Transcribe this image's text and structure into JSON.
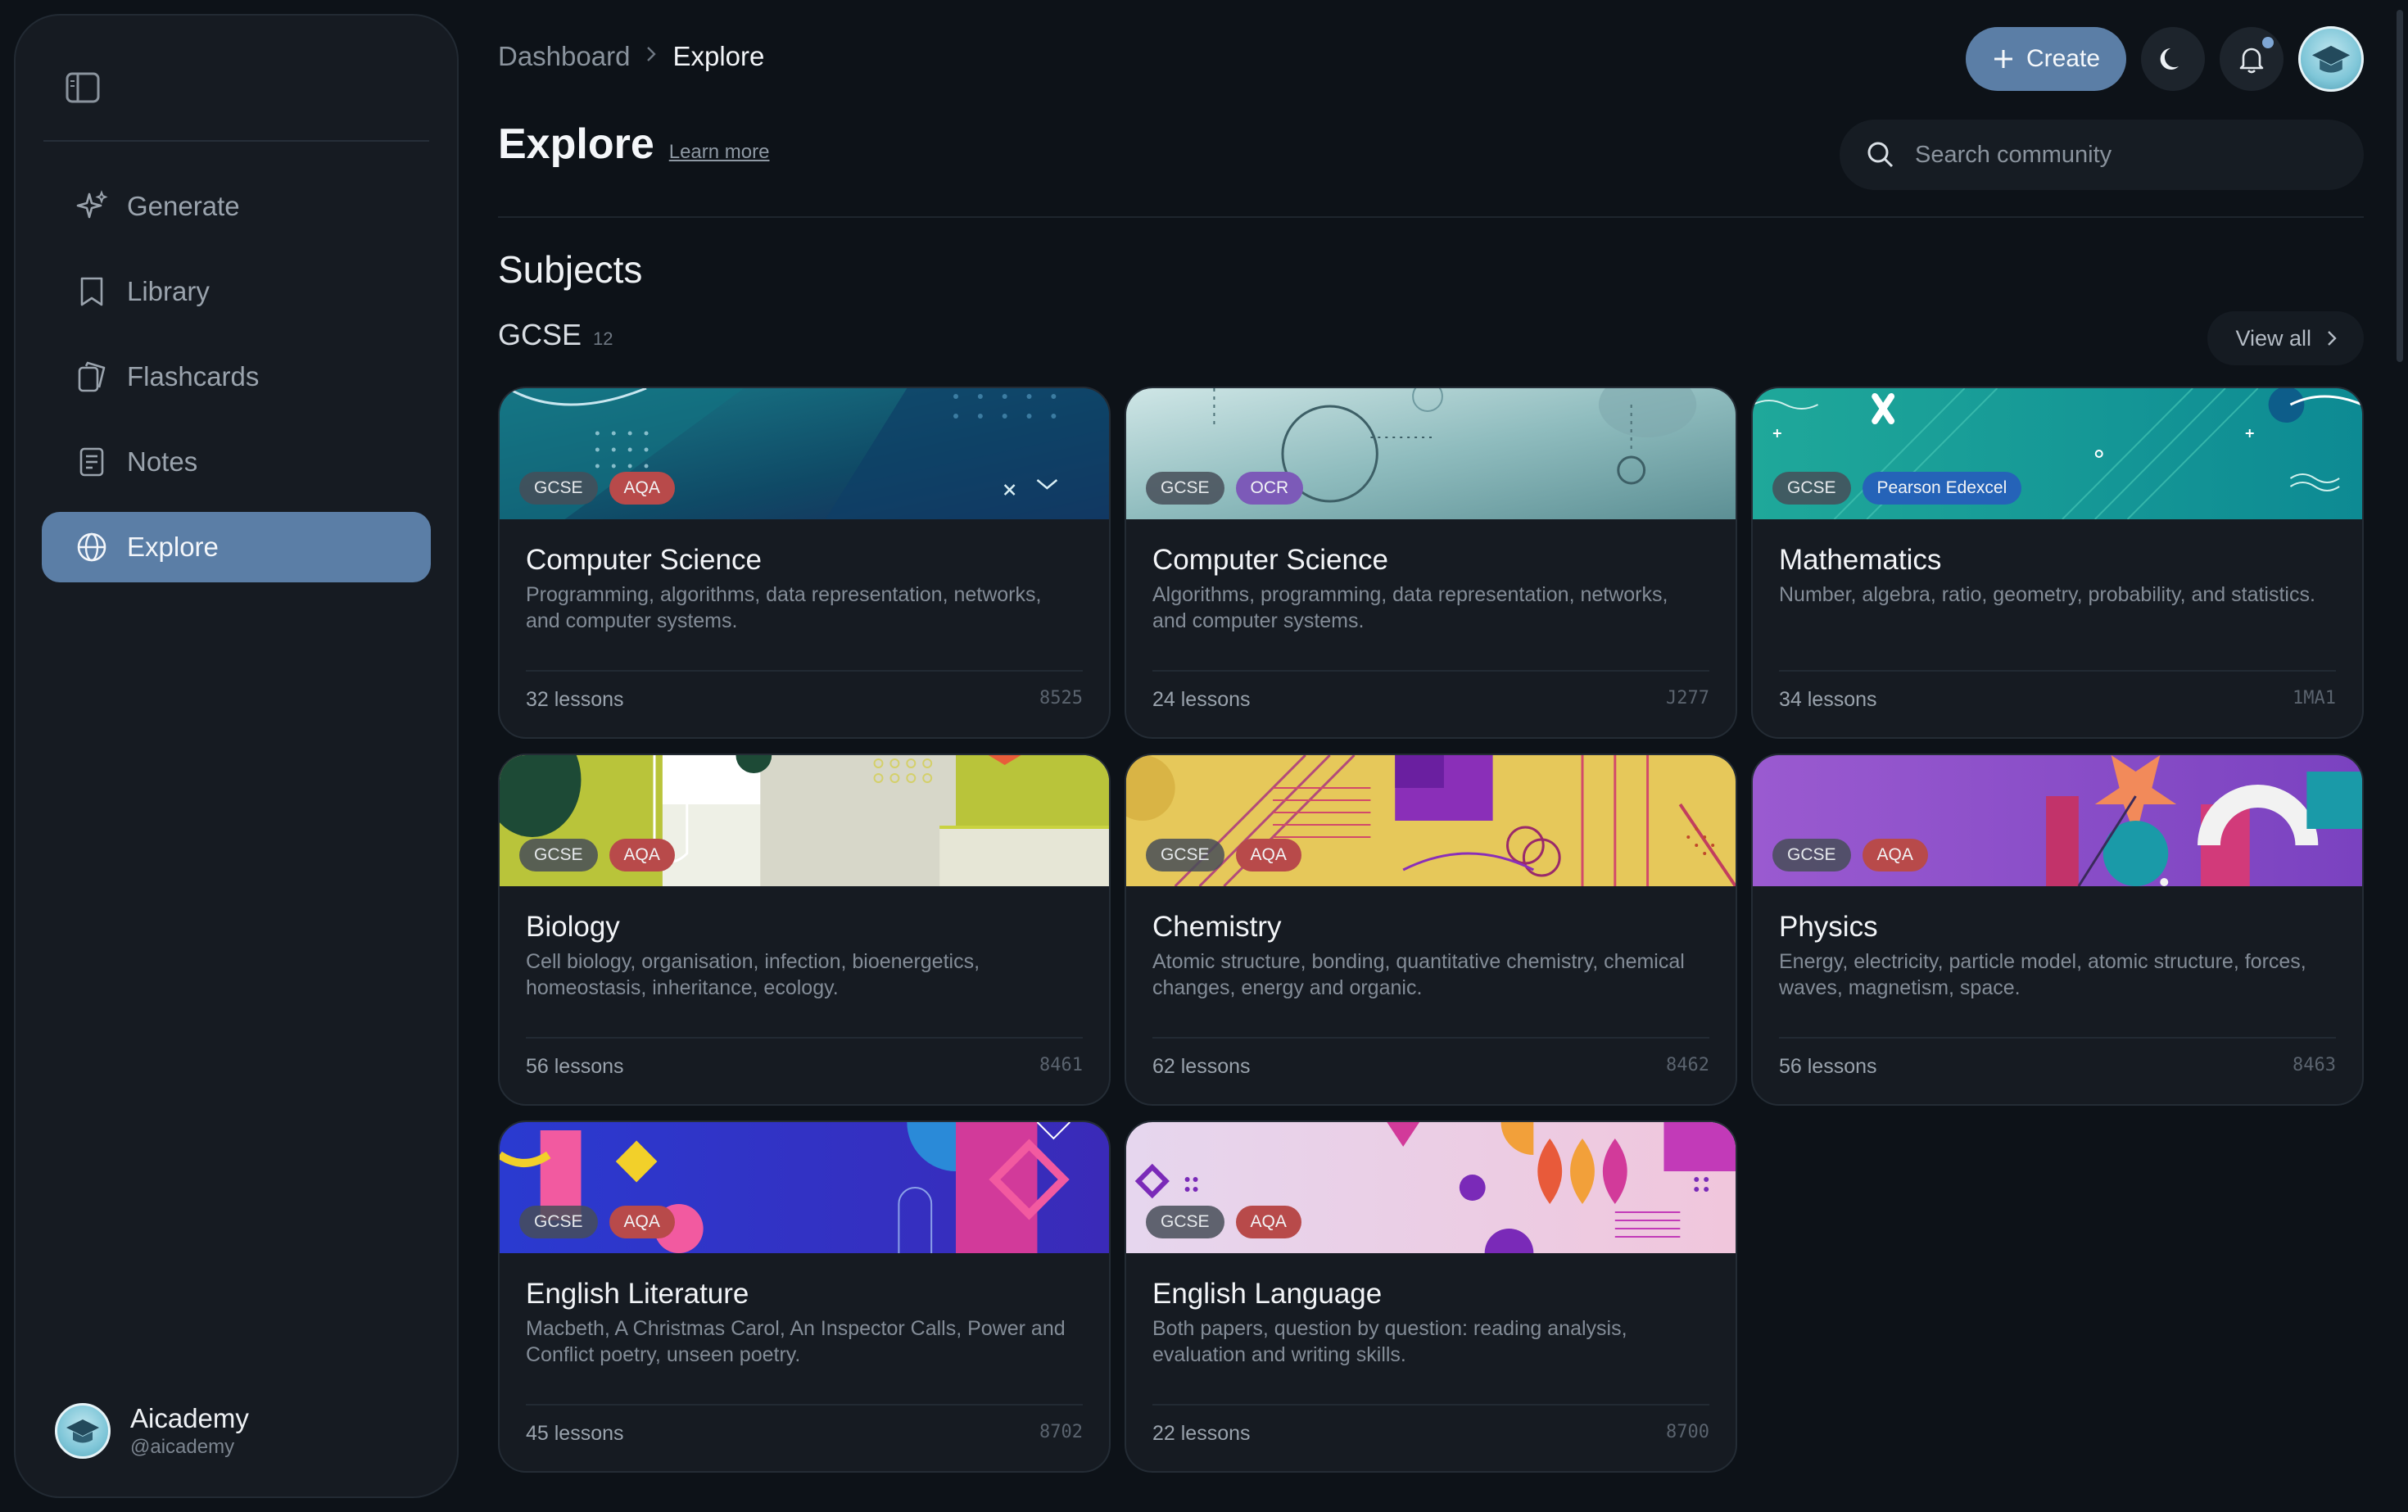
{
  "sidebar": {
    "items": [
      {
        "label": "Generate",
        "icon": "sparkle-icon"
      },
      {
        "label": "Library",
        "icon": "bookmark-icon"
      },
      {
        "label": "Flashcards",
        "icon": "flashcards-icon"
      },
      {
        "label": "Notes",
        "icon": "notes-icon"
      },
      {
        "label": "Explore",
        "icon": "globe-icon",
        "active": true
      }
    ],
    "user": {
      "name": "Aicademy",
      "handle": "@aicademy"
    }
  },
  "header": {
    "breadcrumb": {
      "root": "Dashboard",
      "current": "Explore"
    },
    "create_label": "Create",
    "title": "Explore",
    "learn_more": "Learn more",
    "search_placeholder": "Search community"
  },
  "section": {
    "title": "Subjects",
    "group": "GCSE",
    "count": "12",
    "view_all": "View all"
  },
  "cards": [
    {
      "title": "Computer Science",
      "tags": [
        "GCSE",
        "AQA"
      ],
      "desc": "Programming, algorithms, data representation, networks, and computer systems.",
      "lessons": "32 lessons",
      "code": "8525"
    },
    {
      "title": "Computer Science",
      "tags": [
        "GCSE",
        "OCR"
      ],
      "desc": "Algorithms, programming, data representation, networks, and computer systems.",
      "lessons": "24 lessons",
      "code": "J277"
    },
    {
      "title": "Mathematics",
      "tags": [
        "GCSE",
        "Pearson Edexcel"
      ],
      "desc": "Number, algebra, ratio, geometry, probability, and statistics.",
      "lessons": "34 lessons",
      "code": "1MA1"
    },
    {
      "title": "Biology",
      "tags": [
        "GCSE",
        "AQA"
      ],
      "desc": "Cell biology, organisation, infection, bioenergetics, homeostasis, inheritance, ecology.",
      "lessons": "56 lessons",
      "code": "8461"
    },
    {
      "title": "Chemistry",
      "tags": [
        "GCSE",
        "AQA"
      ],
      "desc": "Atomic structure, bonding, quantitative chemistry, chemical changes, energy and organic.",
      "lessons": "62 lessons",
      "code": "8462"
    },
    {
      "title": "Physics",
      "tags": [
        "GCSE",
        "AQA"
      ],
      "desc": "Energy, electricity, particle model, atomic structure, forces, waves, magnetism, space.",
      "lessons": "56 lessons",
      "code": "8463"
    },
    {
      "title": "English Literature",
      "tags": [
        "GCSE",
        "AQA"
      ],
      "desc": "Macbeth, A Christmas Carol, An Inspector Calls, Power and Conflict poetry, unseen poetry.",
      "lessons": "45 lessons",
      "code": "8702"
    },
    {
      "title": "English Language",
      "tags": [
        "GCSE",
        "AQA"
      ],
      "desc": "Both papers, question by question: reading analysis, evaluation and writing skills.",
      "lessons": "22 lessons",
      "code": "8700"
    }
  ],
  "colors": {
    "accent": "#5b7ea6",
    "aqa": "#b84a4a",
    "ocr": "#7c5ab8",
    "edexcel": "#2563b8"
  }
}
